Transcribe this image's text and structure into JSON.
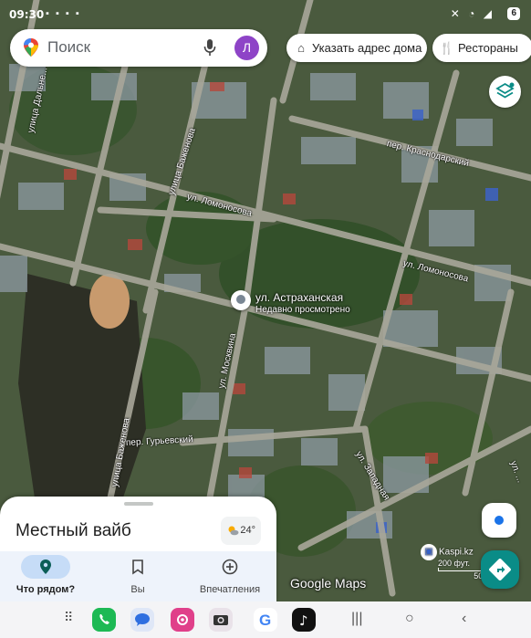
{
  "status_bar": {
    "time": "09:30",
    "battery": "6"
  },
  "search": {
    "placeholder": "Поиск",
    "avatar_letter": "Л"
  },
  "chips": [
    {
      "label": "Указать адрес дома",
      "icon": "home-icon"
    },
    {
      "label": "Рестораны",
      "icon": "restaurant-icon"
    }
  ],
  "map": {
    "street_labels": [
      "улица Дальне...",
      "улица Баженова",
      "ул. Ломоносова",
      "пер. Краснодарский",
      "ул. Ломоносова",
      "ул. Москвина",
      "улица Баженова",
      "пер. Гурьевский",
      "ул. Западная",
      "ул. ..."
    ],
    "place_pin": {
      "title": "ул. Астраханская",
      "subtitle": "Недавно просмотрено"
    },
    "business_label": "Kaspi.kz",
    "scale": {
      "ft": "200 фут.",
      "m": "50 м"
    },
    "watermark": "Google Maps",
    "colors": {
      "road": "#a9a79a",
      "vegetation": "#3f5a2f",
      "roof": "#8d9aa3"
    }
  },
  "sheet": {
    "title": "Местный вайб",
    "weather_temp": "24°",
    "tabs": [
      {
        "label": "Что рядом?",
        "icon": "location-pin-icon",
        "active": true
      },
      {
        "label": "Вы",
        "icon": "bookmark-icon",
        "active": false
      },
      {
        "label": "Впечатления",
        "icon": "add-circle-icon",
        "active": false
      }
    ]
  },
  "nav_apps": [
    "apps-grid-icon",
    "phone-icon",
    "messages-icon",
    "gallery-icon",
    "camera-icon",
    "google-icon",
    "tiktok-icon"
  ],
  "accent_colors": {
    "brand_teal": "#0a8c87",
    "active_tab": "#c6dcf7",
    "avatar": "#8e44c7"
  }
}
